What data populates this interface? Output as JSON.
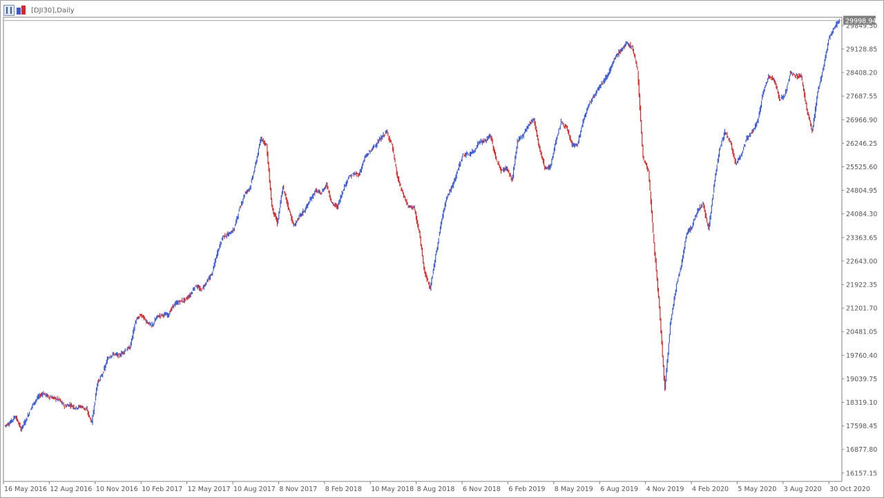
{
  "header": {
    "title": "[DJI30],Daily"
  },
  "colors": {
    "up": "#3b5bd6",
    "down": "#d62a2a",
    "background": "#ffffff",
    "axis": "#808080",
    "last_price_bg": "#808080"
  },
  "chart_data": {
    "type": "line",
    "title": "[DJI30],Daily",
    "price_ticks": [
      "29849.50",
      "29128.85",
      "28408.20",
      "27687.55",
      "26966.90",
      "26246.25",
      "25525.60",
      "24804.95",
      "24084.30",
      "23363.65",
      "22643.00",
      "21922.35",
      "21201.70",
      "20481.05",
      "19760.40",
      "19039.75",
      "18319.10",
      "17598.45",
      "16877.80",
      "16157.15"
    ],
    "time_ticks": [
      "16 May 2016",
      "12 Aug 2016",
      "10 Nov 2016",
      "10 Feb 2017",
      "12 May 2017",
      "10 Aug 2017",
      "8 Nov 2017",
      "8 Feb 2018",
      "10 May 2018",
      "8 Aug 2018",
      "6 Nov 2018",
      "6 Feb 2019",
      "8 May 2019",
      "6 Aug 2019",
      "4 Nov 2019",
      "4 Feb 2020",
      "5 May 2020",
      "3 Aug 2020",
      "30 Oct 2020"
    ],
    "last_price": "29998.94",
    "ylim": [
      15900,
      30100
    ],
    "series": [
      {
        "values": [
          17600,
          17700,
          17900,
          17500,
          17800,
          18200,
          18450,
          18600,
          18500,
          18450,
          18400,
          18200,
          18250,
          18150,
          18200,
          18100,
          17700,
          18900,
          19200,
          19700,
          19800,
          19750,
          19900,
          20000,
          20800,
          21000,
          20800,
          20650,
          20950,
          21000,
          21000,
          21300,
          21400,
          21450,
          21600,
          21900,
          21750,
          22000,
          22250,
          22900,
          23400,
          23450,
          23600,
          24200,
          24700,
          24900,
          25600,
          26400,
          26200,
          24300,
          23800,
          24900,
          24300,
          23700,
          24000,
          24200,
          24500,
          24800,
          24700,
          25000,
          24400,
          24300,
          24800,
          25200,
          25300,
          25300,
          25800,
          26000,
          26200,
          26400,
          26600,
          26200,
          25200,
          24700,
          24300,
          24300,
          23500,
          22300,
          21800,
          22800,
          23800,
          24600,
          24900,
          25400,
          25900,
          25900,
          26000,
          26300,
          26300,
          26500,
          25800,
          25400,
          25500,
          25100,
          26300,
          26500,
          26800,
          27000,
          26100,
          25500,
          25500,
          26300,
          26900,
          26700,
          26200,
          26200,
          26900,
          27400,
          27700,
          28000,
          28200,
          28500,
          28900,
          29100,
          29300,
          29200,
          28500,
          25800,
          25400,
          23200,
          21200,
          18700,
          20700,
          21800,
          22500,
          23500,
          23700,
          24200,
          24400,
          23600,
          24900,
          26100,
          26600,
          26300,
          25600,
          25900,
          26400,
          26600,
          26900,
          27800,
          28300,
          28200,
          27600,
          27700,
          28400,
          28300,
          28300,
          27300,
          26600,
          27800,
          28500,
          29400,
          29800,
          30000
        ]
      }
    ]
  }
}
